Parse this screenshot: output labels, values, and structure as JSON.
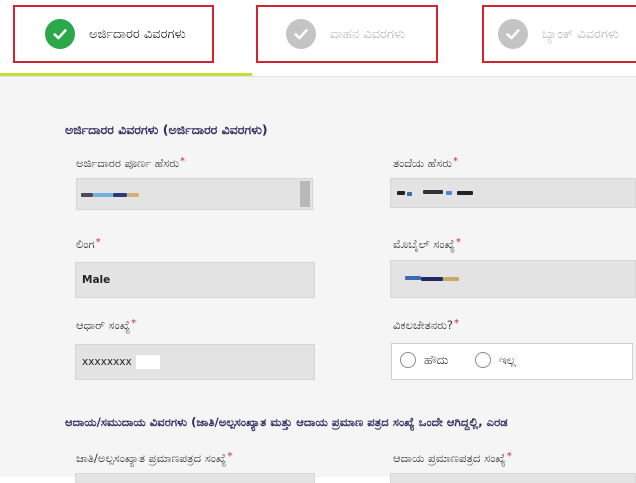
{
  "steps": [
    {
      "label": "ಅರ್ಜಿದಾರರ ವಿವರಗಳು",
      "status": "completed",
      "icon": "check-icon"
    },
    {
      "label": "ವಾಹನ ವಿವರಗಳು",
      "status": "pending",
      "icon": "check-icon"
    },
    {
      "label": "ಬ್ಯಾಂಕ್ ವಿವರಗಳು",
      "status": "pending",
      "icon": "check-icon"
    }
  ],
  "colors": {
    "active_green": "#2aa84a",
    "inactive_gray": "#c4c4c4",
    "highlight_red": "#d0252f",
    "progress_lime": "#c8dc3c",
    "section_title": "#2e2a5e"
  },
  "applicant": {
    "section_title": "ಅರ್ಜಿದಾರರ ವಿವರಗಳು (ಅರ್ಜಿದಾರರ ವಿವರಗಳು)",
    "fields": {
      "full_name": {
        "label": "ಅರ್ಜಿದಾರರ ಪೂರ್ಣ ಹೆಸರು",
        "required": "*",
        "value": ""
      },
      "father_name": {
        "label": "ತಂದೆಯ ಹೆಸರು",
        "required": "*",
        "value": ""
      },
      "gender": {
        "label": "ಲಿಂಗ",
        "required": "*",
        "value": "Male"
      },
      "mobile": {
        "label": "ಮೊಬೈಲ್ ಸಂಖ್ಯೆ",
        "required": "*",
        "value": ""
      },
      "aadhaar": {
        "label": "ಆಧಾರ್ ಸಂಖ್ಯೆ",
        "required": "*",
        "value": "xxxxxxxx"
      },
      "disabled": {
        "label": "ವಿಕಲಚೇತನರು?",
        "required": "*",
        "options": [
          "ಹೌದು",
          "ಇಲ್ಲ"
        ]
      }
    }
  },
  "income": {
    "section_title": "ಆದಾಯ/ಸಮುದಾಯ ವಿವರಗಳು (ಜಾತಿ/ಅಲ್ಪಸಂಖ್ಯಾತ ಮತ್ತು ಆದಾಯ ಪ್ರಮಾಣ ಪತ್ರದ ಸಂಖ್ಯೆ ಒಂದೇ ಆಗಿದ್ದಲ್ಲಿ, ಎರಡ",
    "fields": {
      "caste_cert": {
        "label": "ಜಾತಿ/ಅಲ್ಪಸಂಖ್ಯಾತ ಪ್ರಮಾಣಪತ್ರದ ಸಂಖ್ಯೆ",
        "required": "*"
      },
      "income_cert": {
        "label": "ಆದಾಯ ಪ್ರಮಾಣಪತ್ರದ ಸಂಖ್ಯೆ",
        "required": "*"
      }
    }
  }
}
